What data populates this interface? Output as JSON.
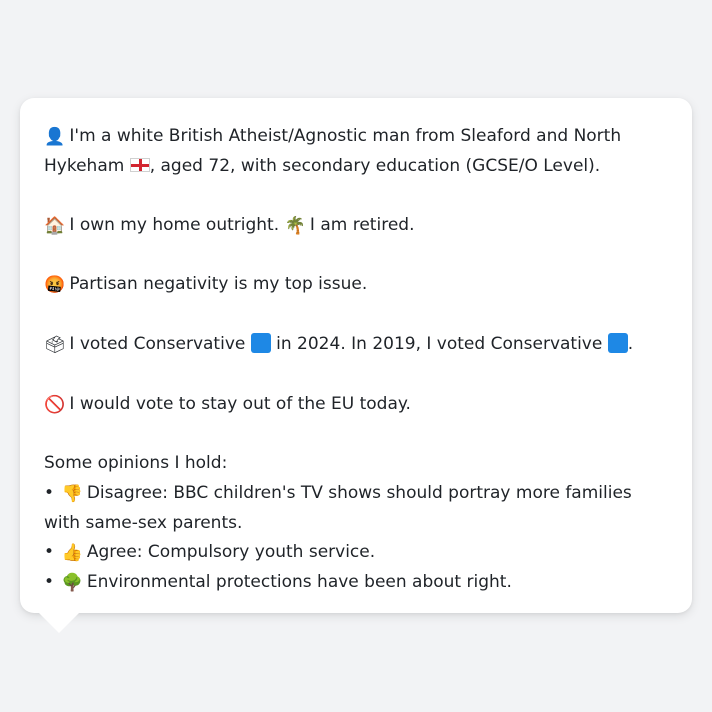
{
  "profile": {
    "intro_prefix": " I'm a white British Atheist/Agnostic man from Sleaford and North Hykeham ",
    "intro_suffix": ", aged 72, with secondary education (GCSE/O Level).",
    "home_text": " I own my home outright. ",
    "retired_text": " I am retired.",
    "issue_text": " Partisan negativity is my top issue.",
    "vote_prefix": " I voted Conservative ",
    "vote_middle": " in 2024. In 2019, I voted Conservative ",
    "vote_suffix": ".",
    "eu_text": " I would vote to stay out of the EU today.",
    "opinions_heading": "Some opinions I hold:",
    "opinions": [
      {
        "bullet": "•",
        "text": " Disagree: BBC children's TV shows should portray more families with same-sex parents."
      },
      {
        "bullet": "•",
        "text": " Agree: Compulsory youth service."
      },
      {
        "bullet": "•",
        "text": " Environmental protections have been about right."
      }
    ]
  },
  "icons": {
    "person": "👤",
    "house": "🏠",
    "palm": "🌴",
    "angry": "🤬",
    "ballot": "🗳",
    "no_entry": "🚫",
    "thumbs_down": "👎",
    "thumbs_up": "👍",
    "tree": "🌳"
  },
  "colors": {
    "conservative": "#1e88e5",
    "england_red": "#d22630",
    "background": "#f2f3f5",
    "card": "#ffffff"
  }
}
